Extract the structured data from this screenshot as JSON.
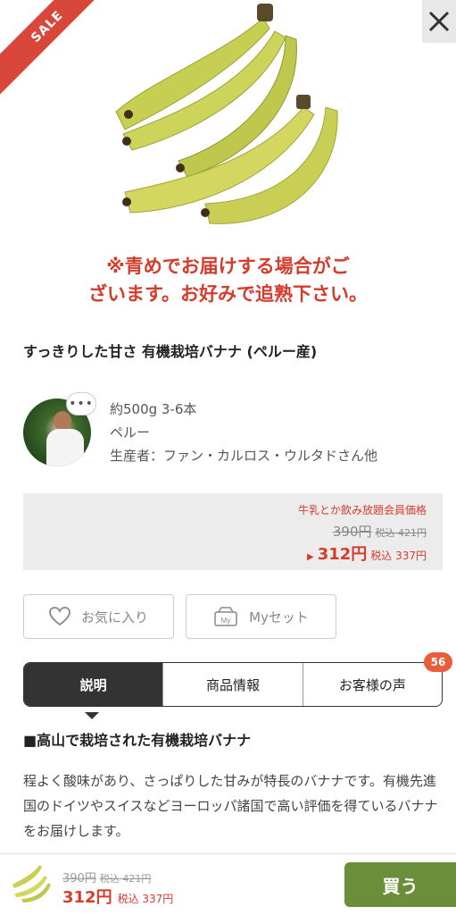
{
  "hero": {
    "sale_badge": "SALE",
    "notice_line1": "※青めでお届けする場合がご",
    "notice_line2": "ざいます。お好みで追熟下さい。"
  },
  "product": {
    "title": "すっきりした甘さ 有機栽培バナナ (ペルー産)",
    "amount": "約500g 3-6本",
    "origin": "ペルー",
    "producer": "生産者：ファン・カルロス・ウルタドさん他",
    "avatar_bubble": "•••"
  },
  "price": {
    "member_label": "牛乳とか飲み放題会員価格",
    "old_price": "390円",
    "old_tax": "税込 421円",
    "arrow": "▶",
    "new_price": "312円",
    "new_tax": "税込 337円"
  },
  "actions": {
    "favorite_label": "お気に入り",
    "myset_label": "Myセット",
    "myset_icon_text": "My"
  },
  "tabs": {
    "items": [
      "説明",
      "商品情報",
      "お客様の声"
    ],
    "review_count": "56"
  },
  "content": {
    "heading": "■高山で栽培された有機栽培バナナ",
    "body": "程よく酸味があり、さっぱりした甘みが特長のバナナです。有機先進国のドイツやスイスなどヨーロッパ諸国で高い評価を得ているバナナをお届けします。"
  },
  "bottom_bar": {
    "old_price": "390円",
    "old_tax": "税込 421円",
    "new_price": "312円",
    "new_tax": "税込 337円",
    "buy_label": "買う"
  },
  "colors": {
    "accent_red": "#d63c2c",
    "buy_green": "#6b8e3a",
    "tab_dark": "#333333",
    "badge_orange": "#e95d3a"
  }
}
